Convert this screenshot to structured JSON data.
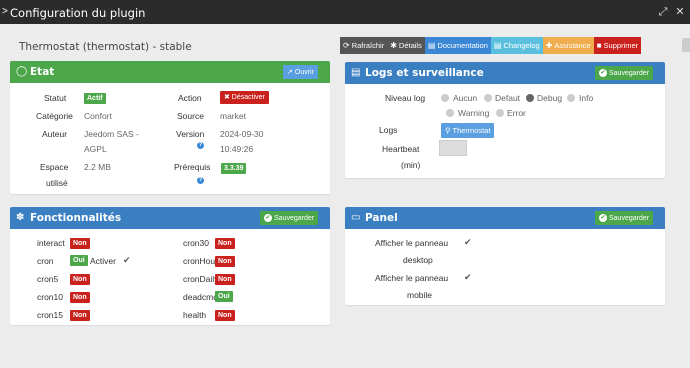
{
  "window": {
    "title": "Configuration du plugin",
    "arrow": ">",
    "minimize": "⤢",
    "close": "✕"
  },
  "plugin": {
    "title": "Thermostat (thermostat) - stable"
  },
  "toolbar": [
    {
      "icon": "⟳",
      "label": "Rafraîchir",
      "color": "#555555"
    },
    {
      "icon": "✱",
      "label": "Détails",
      "color": "#555555"
    },
    {
      "icon": "▤",
      "label": "Documentation",
      "color": "#3a87d6"
    },
    {
      "icon": "▤",
      "label": "Changelog",
      "color": "#5bc0de"
    },
    {
      "icon": "✚",
      "label": "Assistance",
      "color": "#f0ad4e"
    },
    {
      "icon": "■",
      "label": "Supprimer",
      "color": "#c9221e"
    }
  ],
  "etat": {
    "title": "Etat",
    "open_button": "Ouvrir",
    "statut_label": "Statut",
    "statut_value": "Actif",
    "action_label": "Action",
    "action_value": "✖ Désactiver",
    "categorie_label": "Catégorie",
    "categorie_value": "Confort",
    "source_label": "Source",
    "source_value": "market",
    "auteur_label": "Auteur",
    "auteur_value_1": "Jeedom SAS -",
    "auteur_value_2": "AGPL",
    "version_label": "Version",
    "version_value_1": "2024-09-30",
    "version_value_2": "10:49:26",
    "espace_label_1": "Espace",
    "espace_label_2": "utilisé",
    "espace_value": "2.2 MB",
    "prerequis_label": "Prérequis",
    "prerequis_value": "3.3.39"
  },
  "logs": {
    "title": "Logs et surveillance",
    "save_button": "Sauvegarder",
    "niveau_label": "Niveau log",
    "levels": [
      "Aucun",
      "Defaut",
      "Debug",
      "Info",
      "Warning",
      "Error"
    ],
    "selected_level": "Debug",
    "logs_label": "Logs",
    "logs_button": "Thermostat",
    "heartbeat_label_1": "Heartbeat",
    "heartbeat_label_2": "(min)"
  },
  "fonct": {
    "title": "Fonctionnalités",
    "save_button": "Sauvegarder",
    "left": [
      {
        "name": "interact",
        "state": "Non"
      },
      {
        "name": "cron",
        "state": "Oui",
        "extra": "Activer"
      },
      {
        "name": "cron5",
        "state": "Non"
      },
      {
        "name": "cron10",
        "state": "Non"
      },
      {
        "name": "cron15",
        "state": "Non"
      }
    ],
    "right": [
      {
        "name": "cron30",
        "state": "Non"
      },
      {
        "name": "cronHourly",
        "state": "Non"
      },
      {
        "name": "cronDaily",
        "state": "Non"
      },
      {
        "name": "deadcmd",
        "state": "Oui"
      },
      {
        "name": "health",
        "state": "Non"
      }
    ]
  },
  "panel": {
    "title": "Panel",
    "save_button": "Sauvegarder",
    "desktop_label_1": "Afficher le panneau",
    "desktop_label_2": "desktop",
    "mobile_label_1": "Afficher le panneau",
    "mobile_label_2": "mobile"
  },
  "colors": {
    "green_header": "#4ca64a",
    "blue_header": "#3a7fc1",
    "red_badge": "#c9221e",
    "green_badge": "#4ca64a"
  }
}
